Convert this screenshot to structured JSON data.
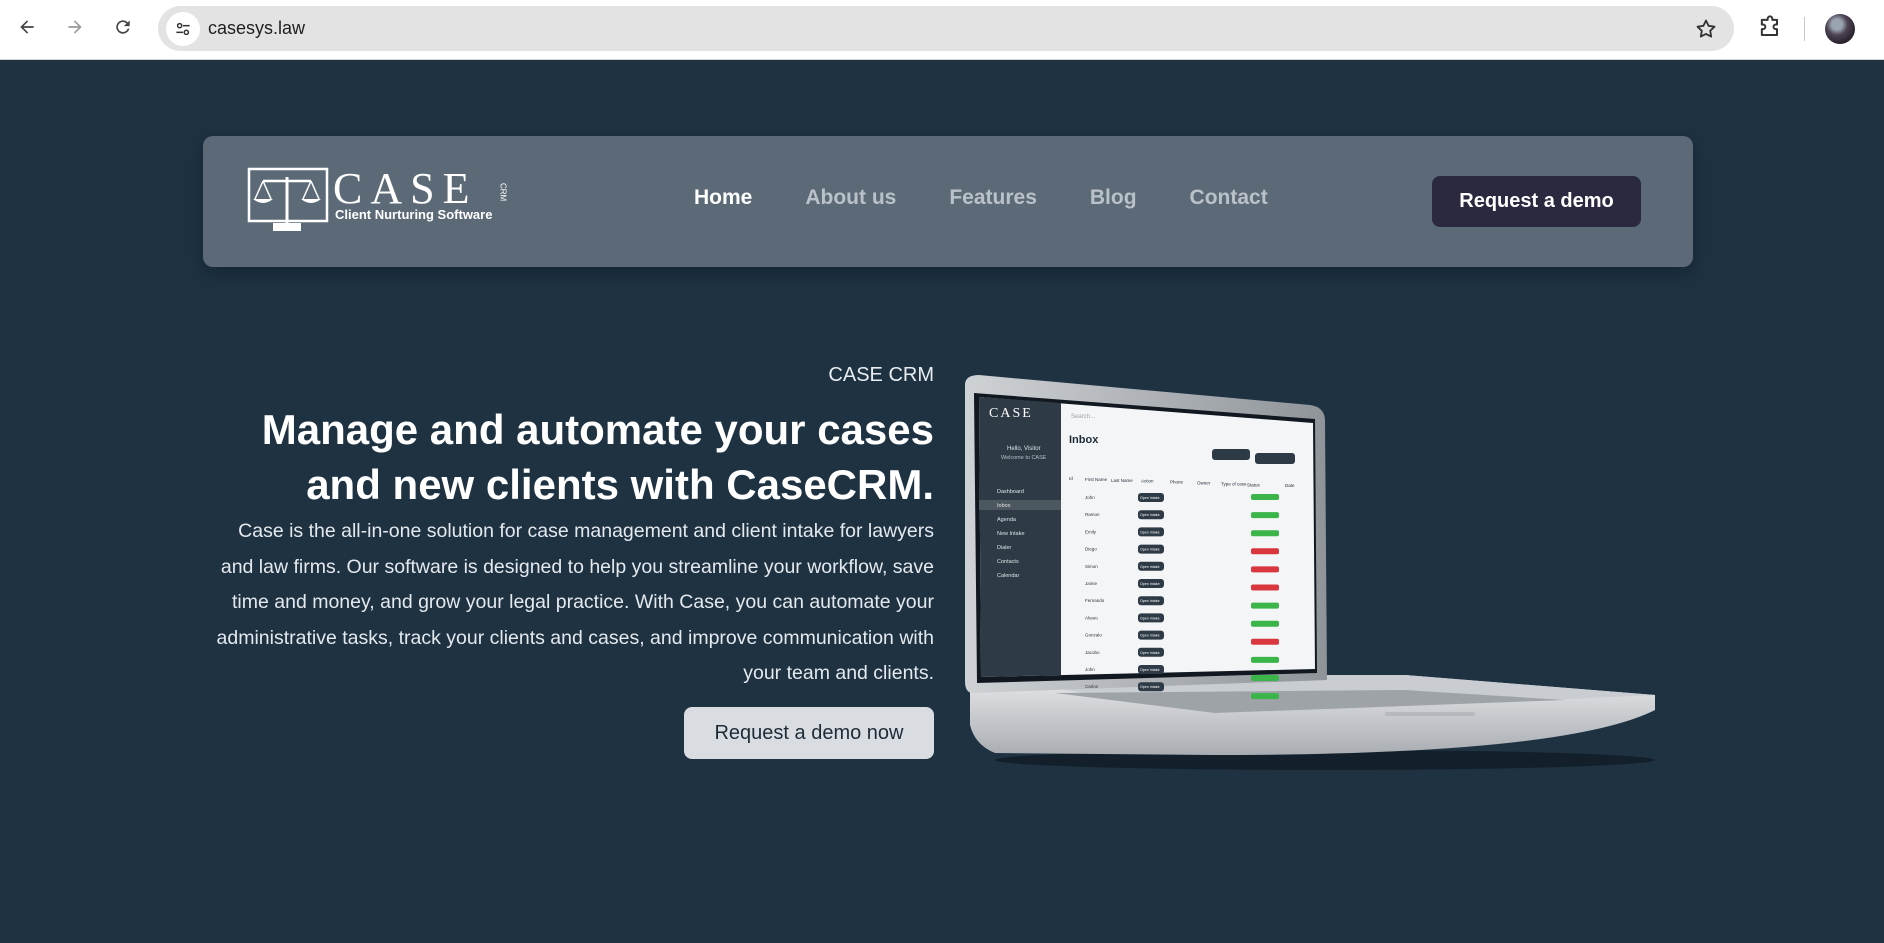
{
  "browser": {
    "url": "casesys.law"
  },
  "navbar": {
    "logo_title": "CASE",
    "logo_crm": "CRM",
    "logo_subtitle": "Client Nurturing Software",
    "links": [
      {
        "label": "Home",
        "active": true
      },
      {
        "label": "About us",
        "active": false
      },
      {
        "label": "Features",
        "active": false
      },
      {
        "label": "Blog",
        "active": false
      },
      {
        "label": "Contact",
        "active": false
      }
    ],
    "cta_label": "Request a demo"
  },
  "hero": {
    "eyebrow": "CASE CRM",
    "headline": "Manage and automate your cases and new clients with CaseCRM.",
    "description": "Case is the all-in-one solution for case management and client intake for lawyers and law firms. Our software is designed to help you streamline your workflow, save time and money, and grow your legal practice. With Case, you can automate your administrative tasks, track your clients and cases, and improve communication with your team and clients.",
    "cta_label": "Request a demo now"
  },
  "mockup": {
    "app_logo": "CASE",
    "search_placeholder": "Search...",
    "greeting": "Hello, Visitor",
    "welcome": "Welcome to CASE",
    "page_title": "Inbox",
    "sidebar": [
      "Dashboard",
      "Inbox",
      "Agenda",
      "New Intake",
      "Dialer",
      "Contacts",
      "Calendar"
    ],
    "columns": [
      "Id",
      "First Name",
      "Last Name",
      "Action",
      "Phone",
      "Owner",
      "Type of case",
      "Status",
      "Date"
    ],
    "first_names": [
      "John",
      "Ramon",
      "Emily",
      "Diego",
      "Simon",
      "Jaime",
      "Fernando",
      "Alvaro",
      "Gonzalo",
      "Jacobo",
      "John",
      "Carlos"
    ],
    "action_label": "Open Intake",
    "colors": {
      "green": "#3bb54a",
      "red": "#d9363e",
      "dark": "#2e3a45"
    }
  },
  "colors": {
    "page_bg": "#1e3242",
    "navbar_bg": "#5c6a77",
    "primary_button": "#2b2940",
    "secondary_button": "#d9dde1"
  }
}
